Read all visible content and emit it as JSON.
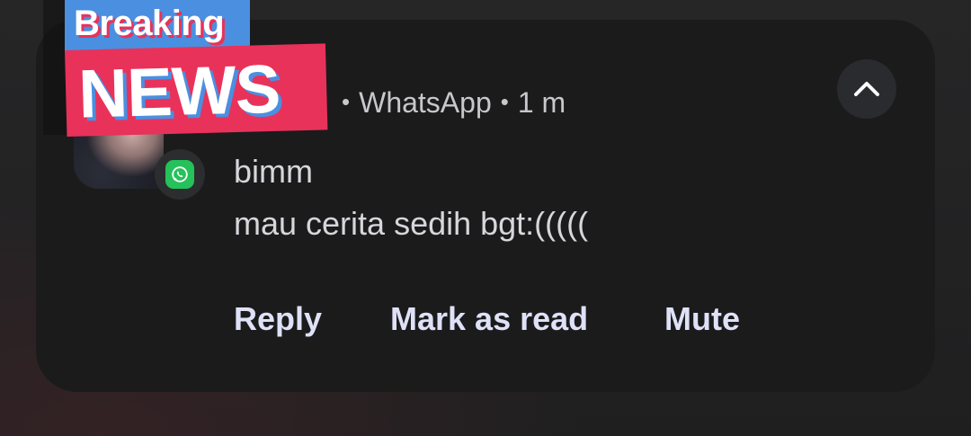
{
  "notification": {
    "app_name": "WhatsApp",
    "time": "1 m",
    "separator": "•",
    "sender": "bimm",
    "message": "mau cerita sedih bgt:(((((",
    "app_icon": "whatsapp-icon",
    "collapse_icon": "chevron-up-icon"
  },
  "sticker": {
    "line1": "Breaking",
    "line2": "NEWS"
  },
  "actions": {
    "reply": "Reply",
    "mark_as_read": "Mark as read",
    "mute": "Mute"
  },
  "colors": {
    "card_background": "#1b1b1c",
    "action_text": "#dfe1f7",
    "whatsapp_green": "#25c15a",
    "sticker_pink": "#e8325a",
    "sticker_blue": "#4b8fe0"
  }
}
